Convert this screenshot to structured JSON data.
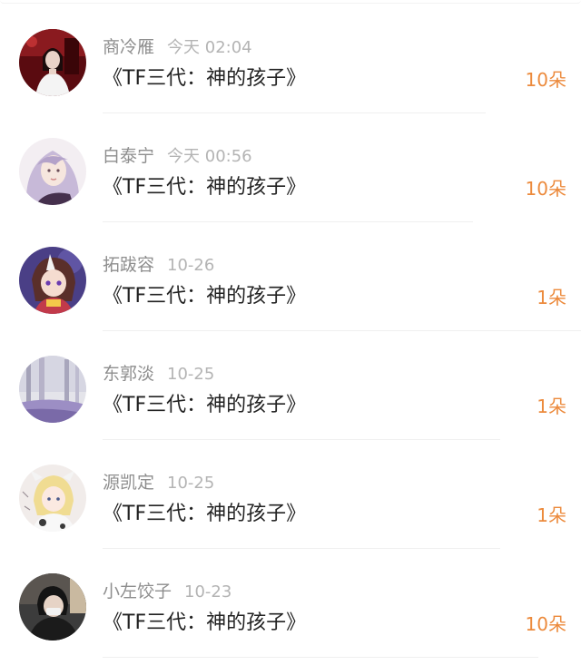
{
  "comments": [
    {
      "user": "商冷雁",
      "time": "今天 02:04",
      "text": "《TF三代：神的孩子》",
      "gift": "10朵",
      "avatar": "avatar-girl-red-room"
    },
    {
      "user": "白泰宁",
      "time": "今天 00:56",
      "text": "《TF三代：神的孩子》",
      "gift": "10朵",
      "avatar": "avatar-girl-lavender-hair"
    },
    {
      "user": "拓跋容",
      "time": "10-26",
      "text": "《TF三代：神的孩子》",
      "gift": "1朵",
      "avatar": "avatar-anime-girl-purple"
    },
    {
      "user": "东郭淡",
      "time": "10-25",
      "text": "《TF三代：神的孩子》",
      "gift": "1朵",
      "avatar": "avatar-misty-forest"
    },
    {
      "user": "源凯定",
      "time": "10-25",
      "text": "《TF三代：神的孩子》",
      "gift": "1朵",
      "avatar": "avatar-anime-cow-costume"
    },
    {
      "user": "小左饺子",
      "time": "10-23",
      "text": "《TF三代：神的孩子》",
      "gift": "10朵",
      "avatar": "avatar-boy-black-hoodie"
    }
  ],
  "colors": {
    "gift": "#ec8a3c",
    "username": "#8e8e8e",
    "time": "#b4b4b4",
    "title": "#222222"
  }
}
